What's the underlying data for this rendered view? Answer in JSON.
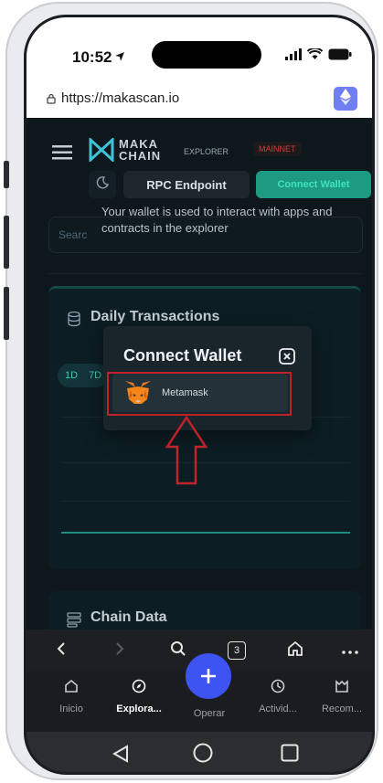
{
  "status_bar": {
    "time": "10:52"
  },
  "browser": {
    "url": "https://makascan.io"
  },
  "header": {
    "logo_line1": "MAKA",
    "logo_line2": "CHAIN",
    "explorer_label": "EXPLORER",
    "network_badge": "MAINNET",
    "rpc_button": "RPC Endpoint",
    "connect_button": "Connect Wallet"
  },
  "search": {
    "placeholder": "Searc"
  },
  "tooltip": {
    "text": "Your wallet is used to interact with apps and contracts in the explorer"
  },
  "daily_transactions": {
    "title": "Daily Transactions",
    "ranges": [
      "1D",
      "7D"
    ]
  },
  "chain_data": {
    "title": "Chain Data"
  },
  "modal": {
    "title": "Connect Wallet",
    "options": [
      {
        "name": "Metamask",
        "icon": "metamask-fox-icon"
      }
    ]
  },
  "browser_toolbar": {
    "tab_count": "3"
  },
  "app_nav": {
    "items": [
      {
        "label": "Inicio",
        "icon": "home-icon"
      },
      {
        "label": "Explora...",
        "icon": "compass-icon",
        "active": true
      },
      {
        "label": "Operar",
        "icon": "plus-icon"
      },
      {
        "label": "Activid...",
        "icon": "clock-icon"
      },
      {
        "label": "Recom...",
        "icon": "gift-icon"
      }
    ]
  },
  "colors": {
    "accent": "#1f9a82",
    "highlight": "#c0222a",
    "fab": "#3d53f2",
    "background": "#0e171c"
  }
}
